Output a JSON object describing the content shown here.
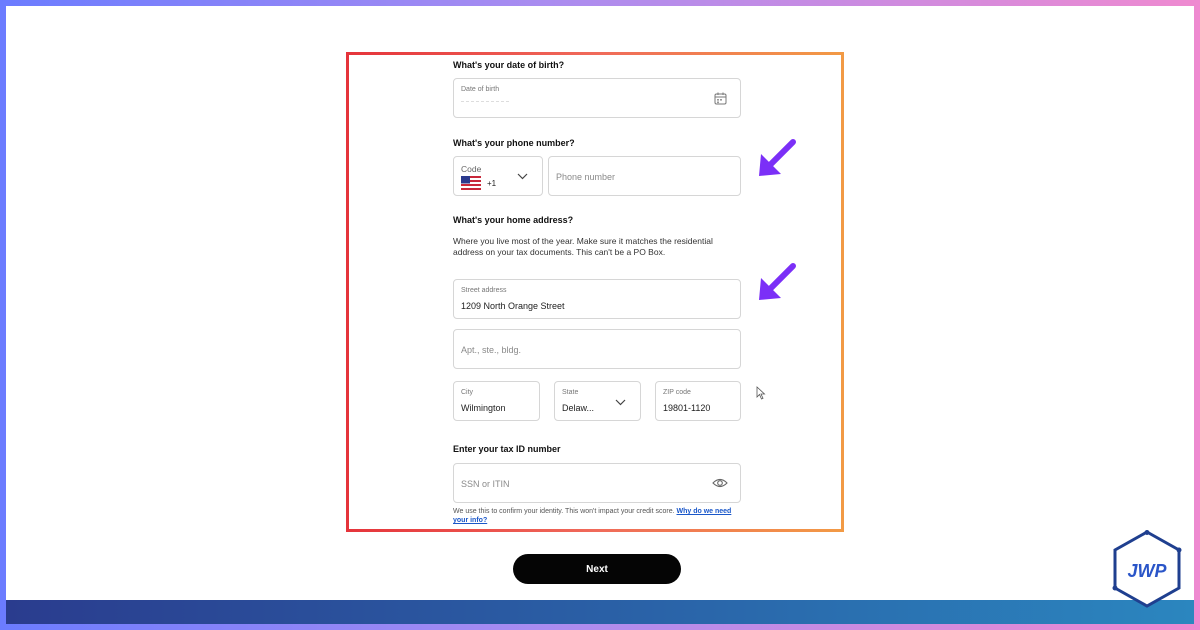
{
  "form": {
    "dob": {
      "question": "What's your date of birth?",
      "label": "Date of birth",
      "icon": "calendar-icon"
    },
    "phone": {
      "question": "What's your phone number?",
      "code_label": "Code",
      "code_value": "+1",
      "flag_icon": "us-flag-icon",
      "placeholder": "Phone number"
    },
    "address": {
      "question": "What's your home address?",
      "description": "Where you live most of the year. Make sure it matches the residential address on your tax documents. This can't be a PO Box.",
      "street_label": "Street address",
      "street_value": "1209 North Orange Street",
      "apt_placeholder": "Apt., ste., bldg.",
      "city_label": "City",
      "city_value": "Wilmington",
      "state_label": "State",
      "state_value": "Delaw...",
      "zip_label": "ZIP code",
      "zip_value": "19801-1120"
    },
    "tax": {
      "question": "Enter your tax ID number",
      "placeholder": "SSN or ITIN",
      "note": "We use this to confirm your identity. This won't impact your credit score.",
      "link": "Why do we need your info?"
    }
  },
  "next_label": "Next",
  "colors": {
    "highlight_frame": "#e5343b",
    "arrow": "#7b2ff7",
    "button": "#050505",
    "link": "#1a57c9"
  },
  "logo": {
    "text": "JWP"
  }
}
